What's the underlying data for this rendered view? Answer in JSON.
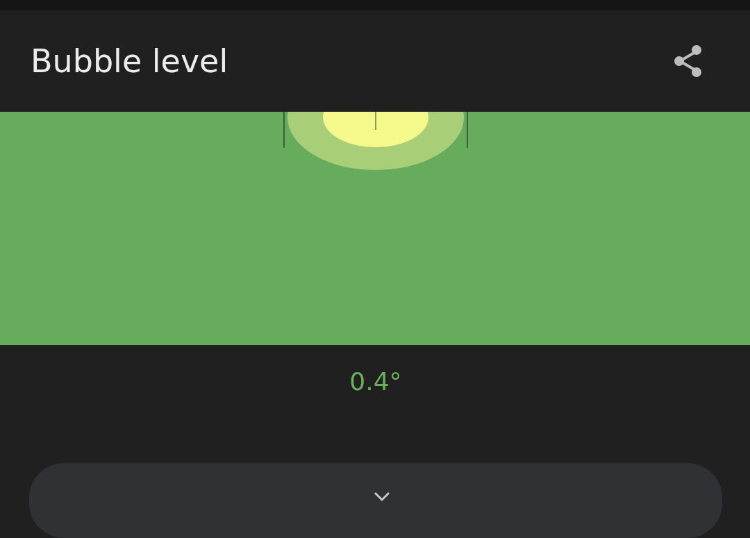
{
  "app_bar": {
    "title": "Bubble level"
  },
  "reading": "0.4°"
}
